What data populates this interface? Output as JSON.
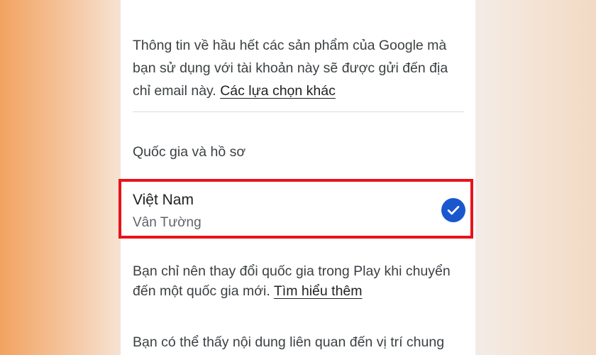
{
  "account_info": {
    "text": "Thông tin về hầu hết các sản phẩm của Google mà bạn sử dụng với tài khoản này sẽ được gửi đến địa chỉ email này. ",
    "link": "Các lựa chọn khác"
  },
  "section": {
    "title": "Quốc gia và hồ sơ"
  },
  "country_option": {
    "country": "Việt Nam",
    "profile": "Vân Tường",
    "selected": true,
    "icon": "check-circle-icon",
    "check_color": "#1a57cf",
    "highlight_color": "#e8131a"
  },
  "change_notice": {
    "text": "Bạn chỉ nên thay đổi quốc gia trong Play khi chuyển đến một quốc gia mới. ",
    "link": "Tìm hiểu thêm"
  },
  "location_notice": {
    "text": "Bạn có thể thấy nội dung liên quan đến vị trí chung"
  }
}
